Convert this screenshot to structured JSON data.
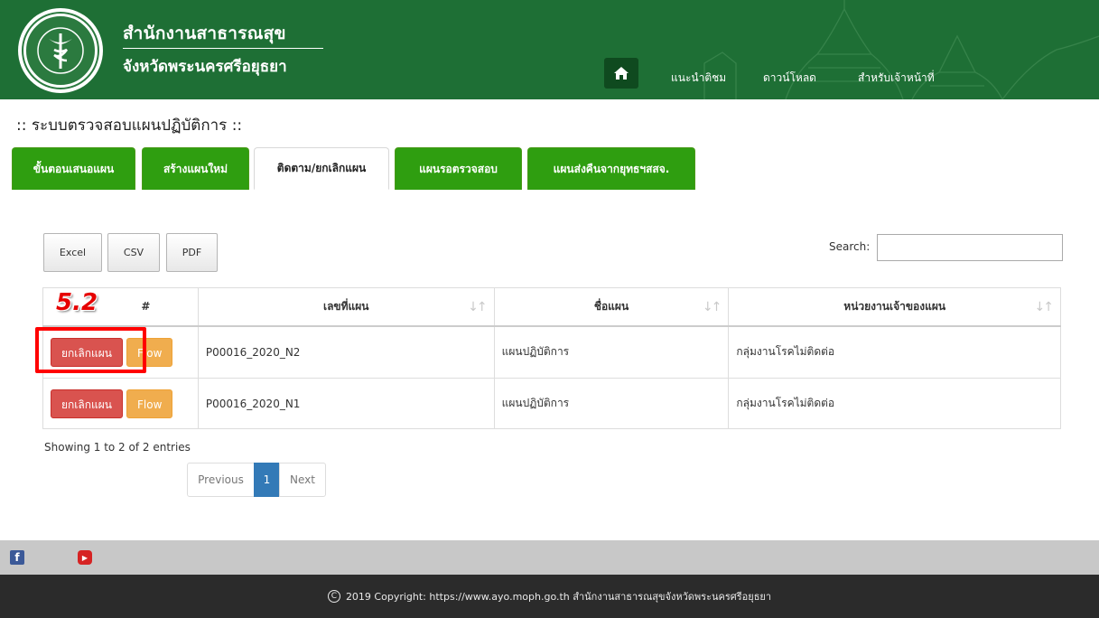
{
  "header": {
    "org_name": "สำนักงานสาธารณสุข",
    "org_province": "จังหวัดพระนครศรีอยุธยา",
    "nav": {
      "home_icon": "home-icon",
      "intro": "แนะนำติชม",
      "download": "ดาวน์โหลด",
      "staff": "สำหรับเจ้าหน้าที่"
    },
    "brand_color": "#1e6f35"
  },
  "page_title": ":: ระบบตรวจสอบแผนปฏิบัติการ ::",
  "tabs": [
    {
      "label": "ขั้นตอนเสนอแผน"
    },
    {
      "label": "สร้างแผนใหม่"
    },
    {
      "label": "ติดตาม/ยกเลิกแผน",
      "active": true
    },
    {
      "label": "แผนรอตรวจสอบ"
    },
    {
      "label": "แผนส่งคืนจากยุทธฯสสจ."
    }
  ],
  "export": {
    "excel": "Excel",
    "csv": "CSV",
    "pdf": "PDF"
  },
  "search": {
    "label": "Search:",
    "value": ""
  },
  "annotation": {
    "step": "5.2"
  },
  "table": {
    "columns": [
      "#",
      "เลขที่แผน",
      "ชื่อแผน",
      "หน่วยงานเจ้าของแผน"
    ],
    "cancel_label": "ยกเลิกแผน",
    "flow_label": "Flow",
    "rows": [
      {
        "plan_no": "P00016_2020_N2",
        "plan_name": "แผนปฏิบัติการ",
        "owner": "กลุ่มงานโรคไม่ติดต่อ"
      },
      {
        "plan_no": "P00016_2020_N1",
        "plan_name": "แผนปฏิบัติการ",
        "owner": "กลุ่มงานโรคไม่ติดต่อ"
      }
    ]
  },
  "info": "Showing 1 to 2 of 2 entries",
  "pager": {
    "prev": "Previous",
    "current": "1",
    "next": "Next"
  },
  "social": {
    "facebook": "f",
    "youtube": "▶"
  },
  "footer": {
    "copyright_symbol": "C",
    "text": "2019 Copyright: https://www.ayo.moph.go.th สำนักงานสาธารณสุขจังหวัดพระนครศรีอยุธยา"
  }
}
